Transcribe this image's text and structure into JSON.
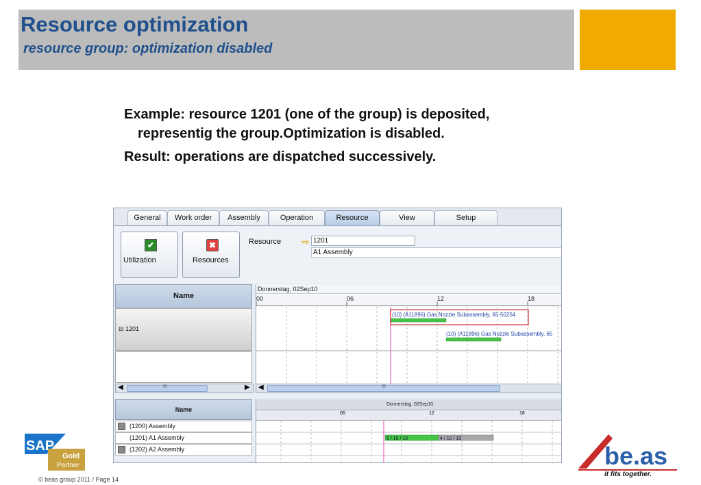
{
  "slide": {
    "title": "Resource optimization",
    "subtitle": "resource group: optimization disabled",
    "paragraph1_line1": "Example: resource 1201 (one of the group) is deposited,",
    "paragraph1_line2": "representig the group.Optimization is disabled.",
    "paragraph2": "Result: operations are dispatched successively.",
    "copyright": "© beas group 2011 / Page 14"
  },
  "app": {
    "tabs": [
      {
        "label": "General"
      },
      {
        "label": "Work order"
      },
      {
        "label": "Assembly"
      },
      {
        "label": "Operation"
      },
      {
        "label": "Resource",
        "active": true
      },
      {
        "label": "View"
      },
      {
        "label": "Setup"
      }
    ],
    "toolbar": {
      "utilization_label": "Utilization",
      "resources_label": "Resources",
      "resource_field_label": "Resource",
      "resource_value": "1201",
      "resource_description": "A1 Assembly"
    },
    "upper_gantt": {
      "name_header": "Name",
      "group_label": "⊟ 1201",
      "date_label": "Donnerstag, 02Sep10",
      "hour_labels": [
        "00",
        "06",
        "12",
        "18"
      ],
      "bar1_label": "(10) (A11896) Gas Nozzle Subassembly, 65-50254",
      "bar2_label": "(10) (A11896) Gas Nozzle Subassembly, 65",
      "scroll_mark": "III"
    },
    "lower_gantt": {
      "name_header": "Name",
      "date_label": "Donnerstag, 02Sep10",
      "hour_labels": [
        "06",
        "12",
        "18"
      ],
      "rows": [
        {
          "label": "(1200) Assembly"
        },
        {
          "label": "(1201) A1 Assembly"
        },
        {
          "label": "(1202) A2 Assembly"
        }
      ],
      "bar1_label": "5 / 10 / 10",
      "bar2_label": "4 / 10 / 10"
    },
    "colors": {
      "title_blue": "#1f4f8c",
      "accent_orange": "#f0aa00",
      "bar_green": "#47c447",
      "bar_gray": "#a8a8a8",
      "highlight_red": "#d03030",
      "now_line": "#f080c0"
    }
  },
  "logos": {
    "sap_text": "SAP",
    "sap_tier": "Gold",
    "sap_partner": "Partner",
    "beas_text": "be.as",
    "beas_tagline": "it fits together."
  }
}
